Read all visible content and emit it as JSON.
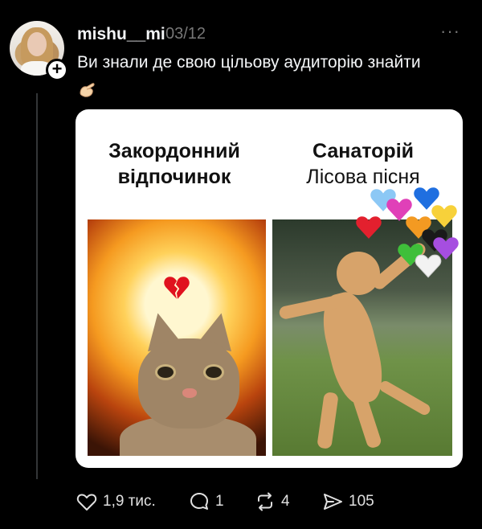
{
  "post": {
    "username": "mishu__mi",
    "date": "03/12",
    "more_label": "···",
    "caption": "Ви знали де свою цільову аудиторію знайти",
    "caption_emoji": "pinching-hand-emoji",
    "follow_label": "+"
  },
  "meme": {
    "left_title": "Закордонний відпочинок",
    "right_title_line1": "Санаторій",
    "right_title_line2": "Лісова пісня",
    "left_icon": "broken-heart-emoji",
    "right_hearts": [
      "light-blue",
      "blue",
      "pink",
      "yellow",
      "red",
      "orange",
      "black",
      "green",
      "white",
      "purple"
    ]
  },
  "actions": {
    "likes": "1,9 тис.",
    "replies": "1",
    "reposts": "4",
    "shares": "105"
  },
  "colors": {
    "background": "#000000",
    "text": "#f3f5f7",
    "muted": "#777777"
  }
}
